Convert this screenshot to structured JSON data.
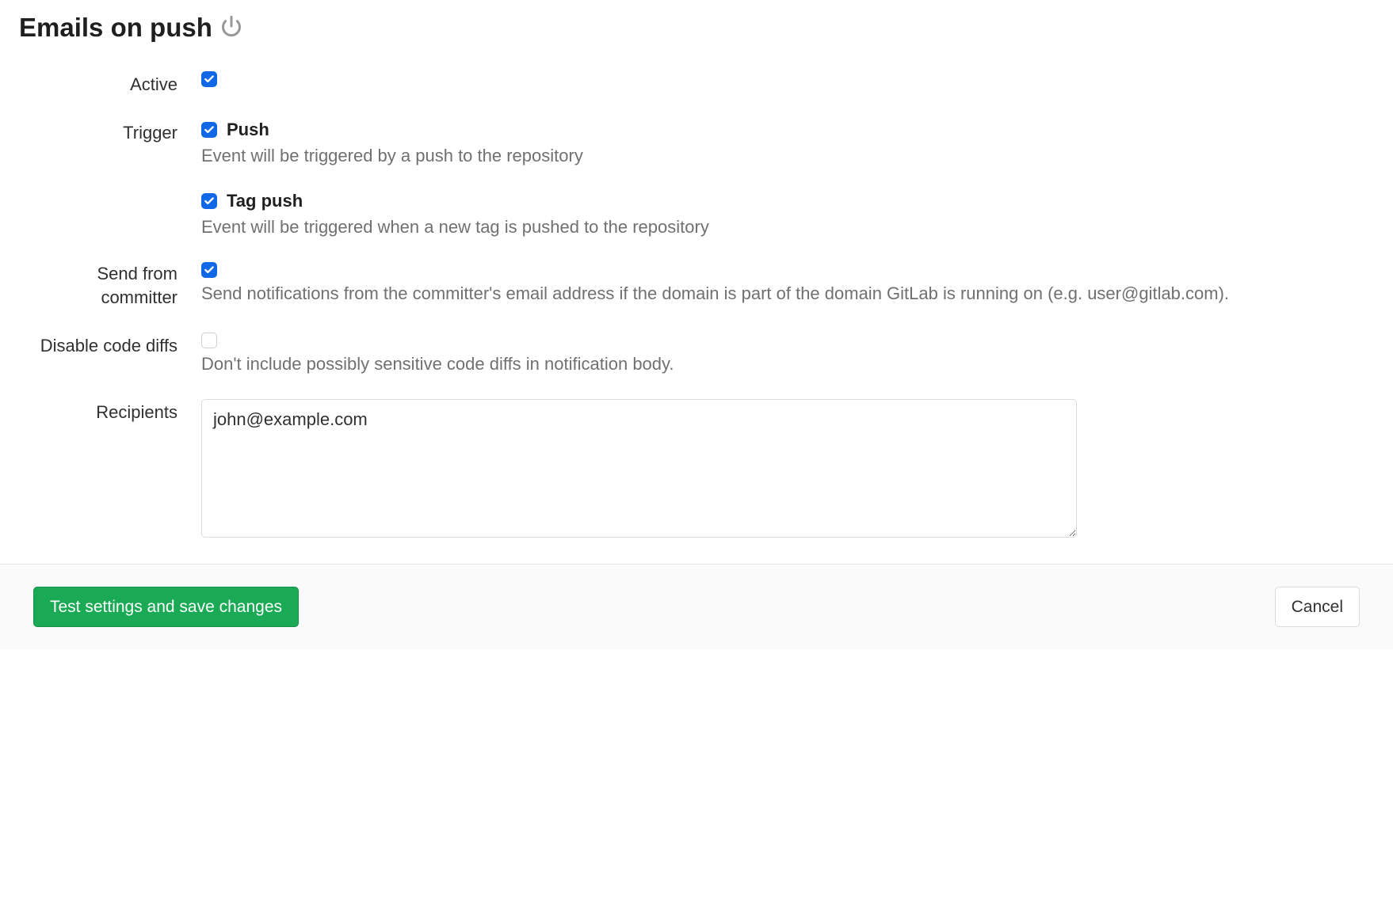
{
  "title": "Emails on push",
  "icon": "power-icon",
  "fields": {
    "active": {
      "label": "Active",
      "checked": true
    },
    "trigger": {
      "label": "Trigger",
      "push": {
        "label": "Push",
        "checked": true,
        "help": "Event will be triggered by a push to the repository"
      },
      "tag_push": {
        "label": "Tag push",
        "checked": true,
        "help": "Event will be triggered when a new tag is pushed to the repository"
      }
    },
    "send_from_committer": {
      "label": "Send from committer",
      "checked": true,
      "help": "Send notifications from the committer's email address if the domain is part of the domain GitLab is running on (e.g. user@gitlab.com)."
    },
    "disable_diffs": {
      "label": "Disable code diffs",
      "checked": false,
      "help": "Don't include possibly sensitive code diffs in notification body."
    },
    "recipients": {
      "label": "Recipients",
      "value": "john@example.com"
    }
  },
  "buttons": {
    "save": "Test settings and save changes",
    "cancel": "Cancel"
  }
}
